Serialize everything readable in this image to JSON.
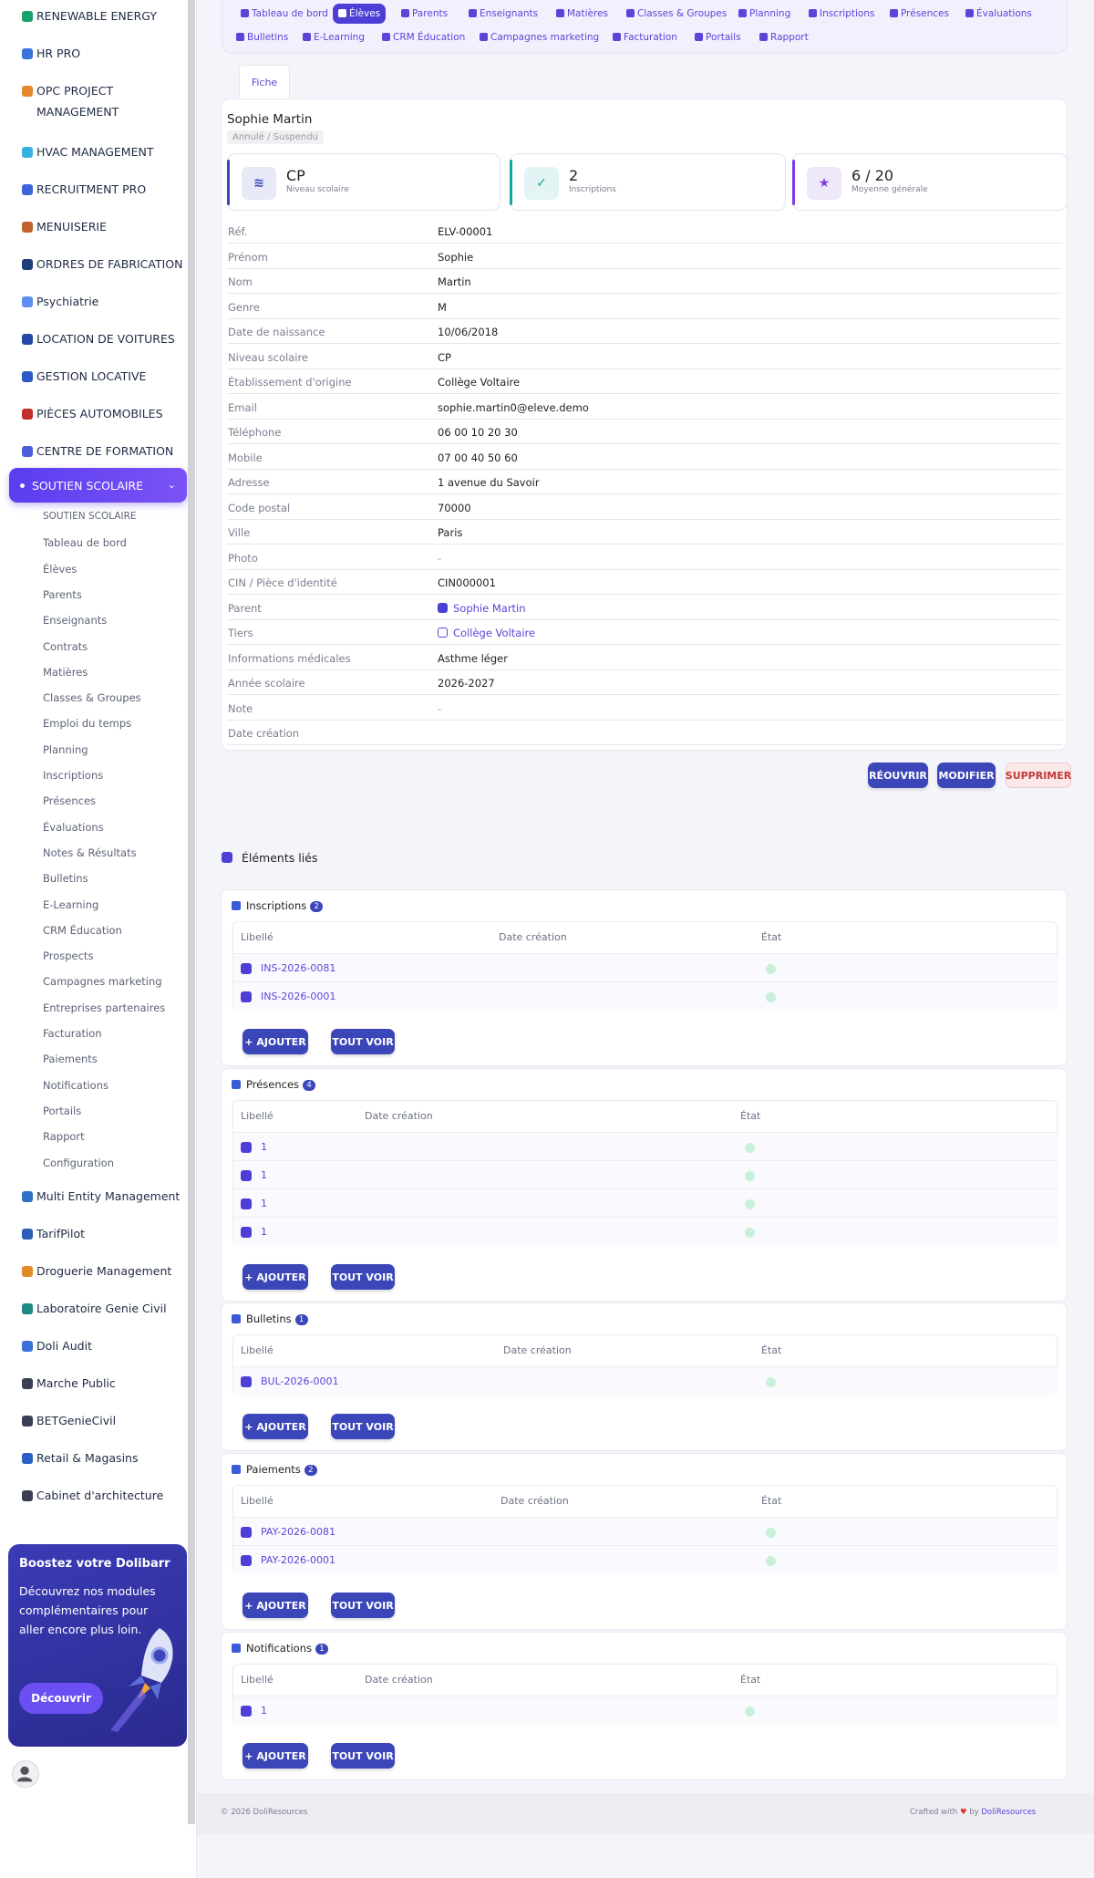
{
  "sidebar": {
    "modules": [
      {
        "label": "RENEWABLE ENERGY",
        "color": "#19a06b"
      },
      {
        "label": "HR PRO",
        "color": "#3a72d8"
      },
      {
        "label": "OPC PROJECT MANAGEMENT",
        "color": "#e6872f"
      },
      {
        "label": "HVAC MANAGEMENT",
        "color": "#3ab0e0"
      },
      {
        "label": "RECRUITMENT PRO",
        "color": "#4065d8"
      },
      {
        "label": "MENUISERIE",
        "color": "#c0622e"
      },
      {
        "label": "ORDRES DE FABRICATION",
        "color": "#1e3e7a"
      },
      {
        "label": "Psychiatrie",
        "color": "#5a8ff0"
      },
      {
        "label": "LOCATION DE VOITURES",
        "color": "#2448a8"
      },
      {
        "label": "GESTION LOCATIVE",
        "color": "#2c58c8"
      },
      {
        "label": "PIÈCES AUTOMOBILES",
        "color": "#c22e2e"
      },
      {
        "label": "CENTRE DE FORMATION",
        "color": "#4a5fd8"
      }
    ],
    "active_module": "SOUTIEN SCOLAIRE",
    "sub_items": [
      "SOUTIEN SCOLAIRE",
      "Tableau de bord",
      "Élèves",
      "Parents",
      "Enseignants",
      "Contrats",
      "Matières",
      "Classes & Groupes",
      "Emploi du temps",
      "Planning",
      "Inscriptions",
      "Présences",
      "Évaluations",
      "Notes & Résultats",
      "Bulletins",
      "E-Learning",
      "CRM Éducation",
      "Prospects",
      "Campagnes marketing",
      "Entreprises partenaires",
      "Facturation",
      "Paiements",
      "Notifications",
      "Portails",
      "Rapport",
      "Configuration"
    ],
    "other_modules": [
      {
        "label": "Multi Entity Management",
        "color": "#3070c8"
      },
      {
        "label": "TarifPilot",
        "color": "#2a60b8"
      },
      {
        "label": "Droguerie Management",
        "color": "#e28a2a"
      },
      {
        "label": "Laboratoire Genie Civil",
        "color": "#1c8a80"
      },
      {
        "label": "Doli Audit",
        "color": "#3a70d8"
      },
      {
        "label": "Marche Public",
        "color": "#3a3f55"
      },
      {
        "label": "BETGenieCivil",
        "color": "#3a3f55"
      },
      {
        "label": "Retail & Magasins",
        "color": "#2a5fc8"
      },
      {
        "label": "Cabinet d'architecture",
        "color": "#3a3f55"
      }
    ],
    "promo": {
      "title": "Boostez votre Dolibarr",
      "text": "Découvrez nos modules complémentaires pour aller encore plus loin.",
      "button": "Découvrir"
    }
  },
  "topnav": {
    "items": [
      "Tableau de bord",
      "Élèves",
      "Parents",
      "Enseignants",
      "Matières",
      "Classes & Groupes",
      "Planning",
      "Inscriptions",
      "Présences",
      "Évaluations",
      "Bulletins",
      "E-Learning",
      "CRM Éducation",
      "Campagnes marketing",
      "Facturation",
      "Portails",
      "Rapport"
    ],
    "active": "Élèves"
  },
  "record": {
    "tab": "Fiche",
    "name": "Sophie Martin",
    "status": "Annulé / Suspendu",
    "stats": [
      {
        "value": "CP",
        "caption": "Niveau scolaire",
        "icon": "layers-icon",
        "color": "#3b46b8"
      },
      {
        "value": "2",
        "caption": "Inscriptions",
        "icon": "clipboard-check-icon",
        "color": "#14a6a0"
      },
      {
        "value": "6 / 20",
        "caption": "Moyenne générale",
        "icon": "star-icon",
        "color": "#7a3fe0"
      }
    ],
    "fields": [
      {
        "key": "Réf.",
        "value": "ELV-00001"
      },
      {
        "key": "Prénom",
        "value": "Sophie"
      },
      {
        "key": "Nom",
        "value": "Martin"
      },
      {
        "key": "Genre",
        "value": "M"
      },
      {
        "key": "Date de naissance",
        "value": "10/06/2018"
      },
      {
        "key": "Niveau scolaire",
        "value": "CP"
      },
      {
        "key": "Établissement d'origine",
        "value": "Collège Voltaire"
      },
      {
        "key": "Email",
        "value": "sophie.martin0@eleve.demo"
      },
      {
        "key": "Téléphone",
        "value": "06 00 10 20 30"
      },
      {
        "key": "Mobile",
        "value": "07 00 40 50 60"
      },
      {
        "key": "Adresse",
        "value": "1 avenue du Savoir"
      },
      {
        "key": "Code postal",
        "value": "70000"
      },
      {
        "key": "Ville",
        "value": "Paris"
      },
      {
        "key": "Photo",
        "value": "-"
      },
      {
        "key": "CIN / Pièce d'identité",
        "value": "CIN000001"
      },
      {
        "key": "Parent",
        "value": "Sophie Martin"
      },
      {
        "key": "Tiers",
        "value": "Collège Voltaire"
      },
      {
        "key": "Informations médicales",
        "value": "Asthme léger"
      },
      {
        "key": "Année scolaire",
        "value": "2026-2027"
      },
      {
        "key": "Note",
        "value": "-"
      },
      {
        "key": "Date création",
        "value": ""
      }
    ],
    "actions": {
      "reopen": "RÉOUVRIR",
      "modify": "MODIFIER",
      "delete": "SUPPRIMER"
    }
  },
  "linked": {
    "title": "Éléments liés",
    "col_label": "Libellé",
    "col_date": "Date création",
    "col_state": "État",
    "add_label": "+ AJOUTER",
    "all_label": "TOUT VOIR",
    "sections": [
      {
        "title": "Inscriptions",
        "count": "2",
        "rows": [
          "INS-2026-0081",
          "INS-2026-0001"
        ]
      },
      {
        "title": "Présences",
        "count": "4",
        "rows": [
          "1",
          "1",
          "1",
          "1"
        ]
      },
      {
        "title": "Bulletins",
        "count": "1",
        "rows": [
          "BUL-2026-0001"
        ]
      },
      {
        "title": "Paiements",
        "count": "2",
        "rows": [
          "PAY-2026-0081",
          "PAY-2026-0001"
        ]
      },
      {
        "title": "Notifications",
        "count": "1",
        "rows": [
          "1"
        ]
      }
    ]
  },
  "footer": {
    "left": "© 2026 DoliResources",
    "crafted": "Crafted with",
    "by": "by",
    "brand": "DoliResources"
  }
}
